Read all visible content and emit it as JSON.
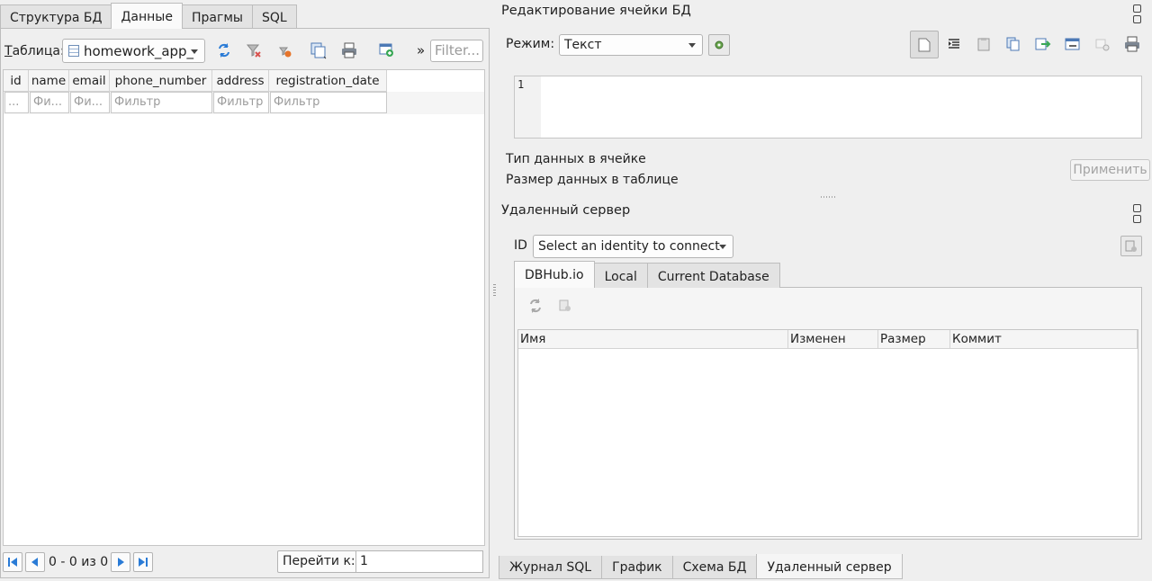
{
  "main_tabs": [
    "Структура БД",
    "Данные",
    "Прагмы",
    "SQL"
  ],
  "data_tab": {
    "table_label": "Таблица:",
    "table_label_mnemonic": "Т",
    "table_label_rest": "аблица:",
    "table_name": "homework_app_",
    "filter_placeholder": "Filter...",
    "more_glyph": "»",
    "columns": [
      "id",
      "name",
      "email",
      "phone_number",
      "address",
      "registration_date"
    ],
    "column_filters": [
      "...",
      "Фи...",
      "Фи...",
      "Фильтр",
      "Фильтр",
      "Фильтр"
    ],
    "record_count": "0 - 0 из 0",
    "goto_label": "Перейти к:",
    "goto_value": "1"
  },
  "edit_cell": {
    "title": "Редактирование ячейки БД",
    "mode_label": "Режим:",
    "mode_value": "Текст",
    "line_number": "1",
    "data_type_label": "Тип данных в ячейке",
    "data_size_label": "Размер данных в таблице",
    "apply_label": "Применить"
  },
  "remote": {
    "title": "Удаленный сервер",
    "id_label": "ID",
    "identity_placeholder": "Select an identity to connect",
    "tabs": [
      "DBHub.io",
      "Local",
      "Current Database"
    ],
    "columns": [
      "Имя",
      "Изменен",
      "Размер",
      "Коммит"
    ]
  },
  "bottom_tabs": [
    "Журнал SQL",
    "График",
    "Схема БД",
    "Удаленный сервер"
  ],
  "icons": {
    "refresh": "refresh-icon",
    "clear_filters": "clear-filters-icon",
    "delete_filter": "delete-filter-icon",
    "copy": "copy-icon",
    "print": "print-icon",
    "insert_record": "insert-record-icon"
  }
}
